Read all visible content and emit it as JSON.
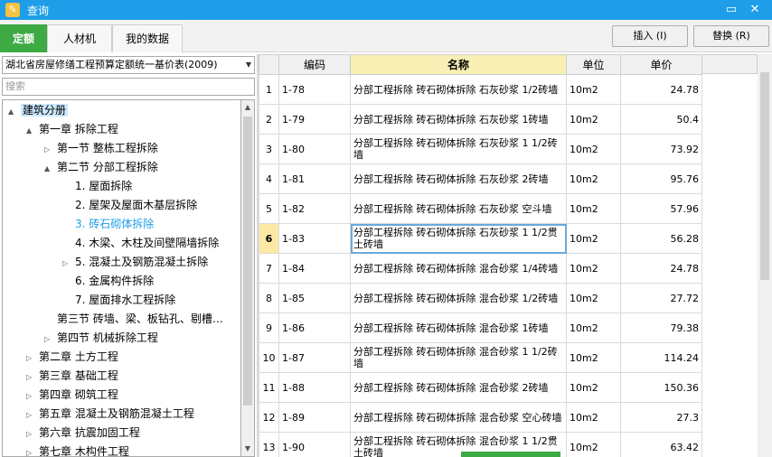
{
  "window": {
    "title": "查询",
    "app_icon": "app-logo-icon",
    "controls": [
      "▭",
      "✕"
    ]
  },
  "tabs": [
    {
      "label": "定额",
      "active": true
    },
    {
      "label": "人材机"
    },
    {
      "label": "我的数据"
    }
  ],
  "buttons": {
    "insert": "插入 (I)",
    "replace": "替换 (R)"
  },
  "dataset": {
    "selected": "湖北省房屋修缮工程预算定额统一基价表(2009)"
  },
  "search": {
    "placeholder": "搜索"
  },
  "tree": [
    {
      "label": "建筑分册",
      "depth": 0,
      "toggle": "▲",
      "selected": true
    },
    {
      "label": "第一章  拆除工程",
      "depth": 1,
      "toggle": "▲"
    },
    {
      "label": "第一节  整栋工程拆除",
      "depth": 2,
      "toggle": "▷"
    },
    {
      "label": "第二节  分部工程拆除",
      "depth": 2,
      "toggle": "▲"
    },
    {
      "label": "1.  屋面拆除",
      "depth": 3
    },
    {
      "label": "2.  屋架及屋面木基层拆除",
      "depth": 3
    },
    {
      "label": "3.  砖石砌体拆除",
      "depth": 3,
      "current": true
    },
    {
      "label": "4.  木梁、木柱及间壁隔墙拆除",
      "depth": 3
    },
    {
      "label": "5.  混凝土及钢筋混凝土拆除",
      "depth": 3,
      "toggle": "▷"
    },
    {
      "label": "6.  金属构件拆除",
      "depth": 3
    },
    {
      "label": "7.  屋面排水工程拆除",
      "depth": 3
    },
    {
      "label": "第三节  砖墙、梁、板钻孔、剔槽…",
      "depth": 2
    },
    {
      "label": "第四节  机械拆除工程",
      "depth": 2,
      "toggle": "▷"
    },
    {
      "label": "第二章  土方工程",
      "depth": 1,
      "toggle": "▷"
    },
    {
      "label": "第三章  基础工程",
      "depth": 1,
      "toggle": "▷"
    },
    {
      "label": "第四章  砌筑工程",
      "depth": 1,
      "toggle": "▷"
    },
    {
      "label": "第五章  混凝土及钢筋混凝土工程",
      "depth": 1,
      "toggle": "▷"
    },
    {
      "label": "第六章  抗震加固工程",
      "depth": 1,
      "toggle": "▷"
    },
    {
      "label": "第七章  木构件工程",
      "depth": 1,
      "toggle": "▷"
    }
  ],
  "table": {
    "headers": [
      "",
      "编码",
      "名称",
      "单位",
      "单价"
    ],
    "rows": [
      {
        "n": "1",
        "code": "1-78",
        "name": "分部工程拆除 砖石砌体拆除 石灰砂浆 1/2砖墙",
        "unit": "10m2",
        "price": "24.78"
      },
      {
        "n": "2",
        "code": "1-79",
        "name": "分部工程拆除 砖石砌体拆除 石灰砂浆 1砖墙",
        "unit": "10m2",
        "price": "50.4"
      },
      {
        "n": "3",
        "code": "1-80",
        "name": "分部工程拆除 砖石砌体拆除 石灰砂浆 1 1/2砖墙",
        "unit": "10m2",
        "price": "73.92"
      },
      {
        "n": "4",
        "code": "1-81",
        "name": "分部工程拆除 砖石砌体拆除 石灰砂浆 2砖墙",
        "unit": "10m2",
        "price": "95.76"
      },
      {
        "n": "5",
        "code": "1-82",
        "name": "分部工程拆除 砖石砌体拆除 石灰砂浆 空斗墙",
        "unit": "10m2",
        "price": "57.96"
      },
      {
        "n": "6",
        "code": "1-83",
        "name": "分部工程拆除 砖石砌体拆除 石灰砂浆 1 1/2贯土砖墙",
        "unit": "10m2",
        "price": "56.28",
        "selected": true
      },
      {
        "n": "7",
        "code": "1-84",
        "name": "分部工程拆除 砖石砌体拆除 混合砂浆 1/4砖墙",
        "unit": "10m2",
        "price": "24.78"
      },
      {
        "n": "8",
        "code": "1-85",
        "name": "分部工程拆除 砖石砌体拆除 混合砂浆 1/2砖墙",
        "unit": "10m2",
        "price": "27.72"
      },
      {
        "n": "9",
        "code": "1-86",
        "name": "分部工程拆除 砖石砌体拆除 混合砂浆 1砖墙",
        "unit": "10m2",
        "price": "79.38"
      },
      {
        "n": "10",
        "code": "1-87",
        "name": "分部工程拆除 砖石砌体拆除 混合砂浆 1 1/2砖墙",
        "unit": "10m2",
        "price": "114.24"
      },
      {
        "n": "11",
        "code": "1-88",
        "name": "分部工程拆除 砖石砌体拆除 混合砂浆 2砖墙",
        "unit": "10m2",
        "price": "150.36"
      },
      {
        "n": "12",
        "code": "1-89",
        "name": "分部工程拆除 砖石砌体拆除 混合砂浆 空心砖墙",
        "unit": "10m2",
        "price": "27.3"
      },
      {
        "n": "13",
        "code": "1-90",
        "name": "分部工程拆除 砖石砌体拆除 混合砂浆 1 1/2贯土砖墙",
        "unit": "10m2",
        "price": "63.42"
      }
    ]
  },
  "colors": {
    "titlebar": "#1e9ee8",
    "active_tab": "#3daa43",
    "selection": "#cce8ff"
  }
}
